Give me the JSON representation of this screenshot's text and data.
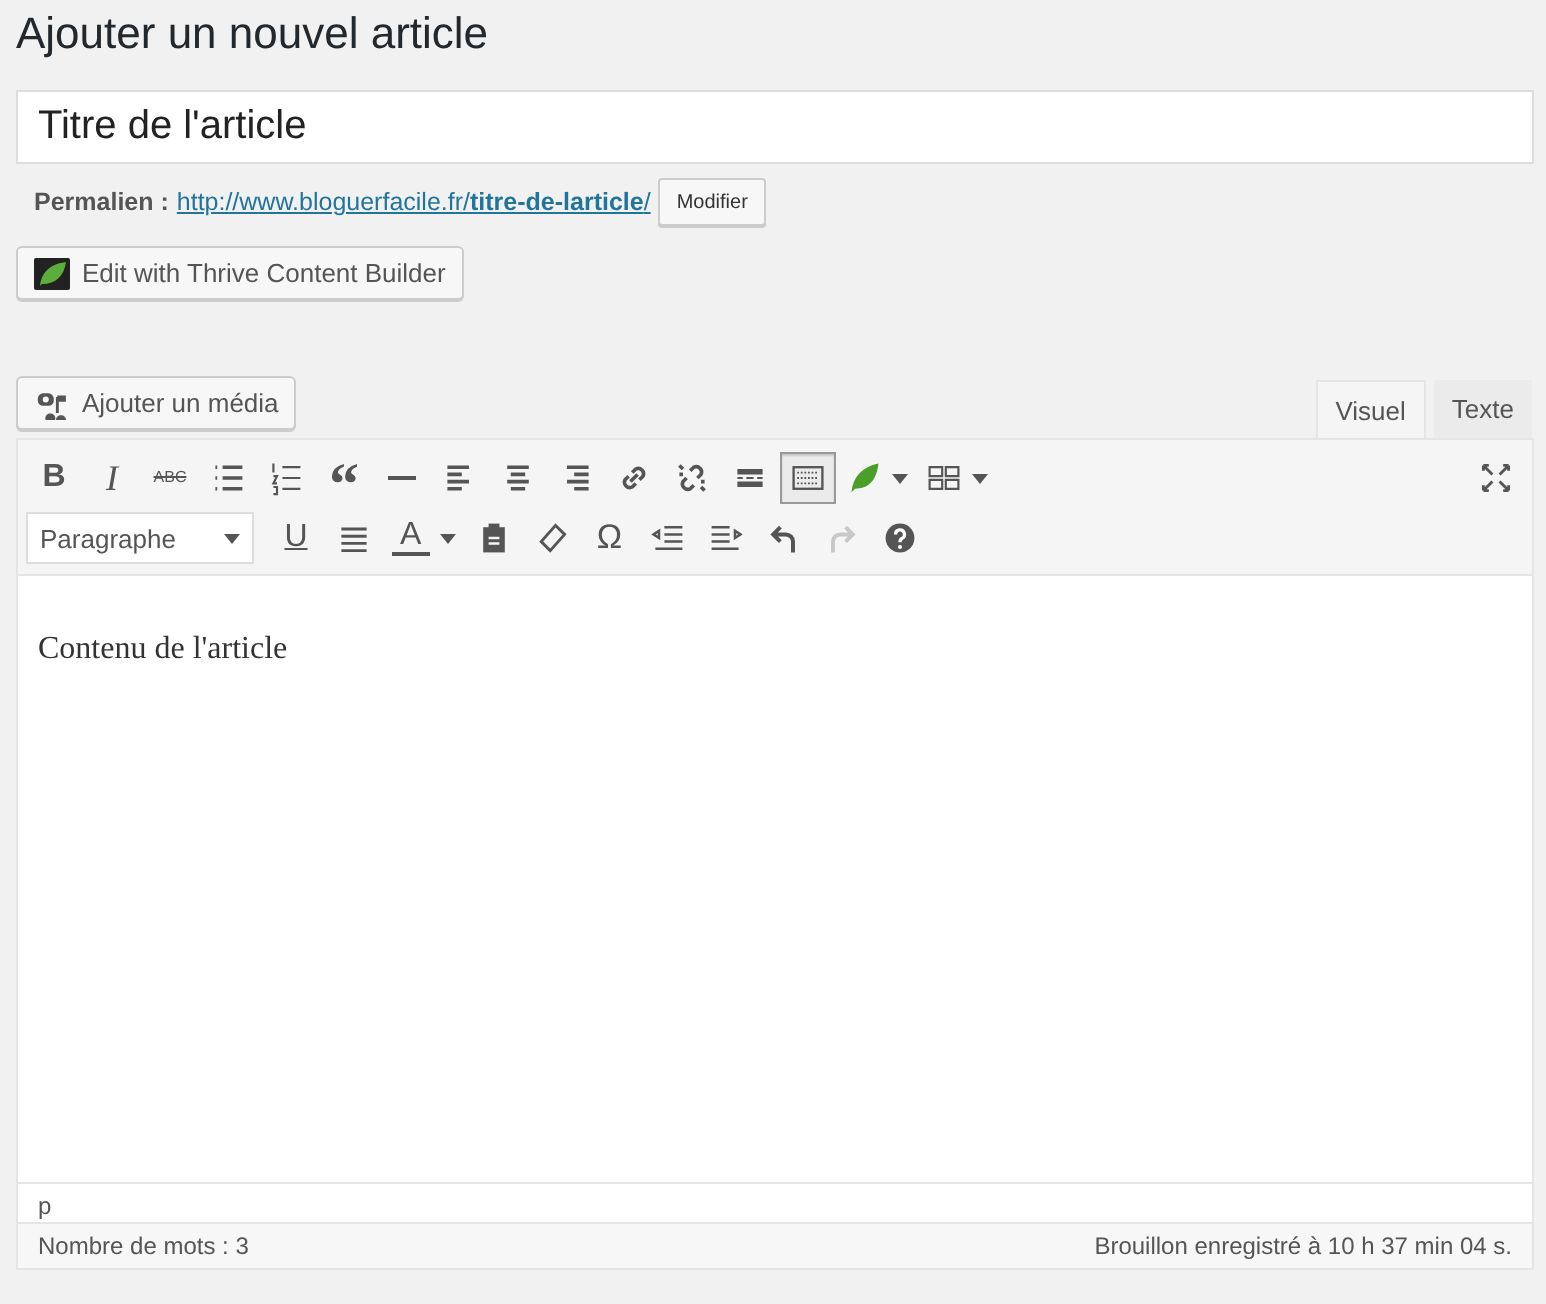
{
  "page_title": "Ajouter un nouvel article",
  "title_field": {
    "value": "Titre de l'article"
  },
  "permalink": {
    "label": "Permalien :",
    "url_base": "http://www.bloguerfacile.fr/",
    "url_slug": "titre-de-larticle",
    "url_end": "/",
    "button": "Modifier"
  },
  "builder_button": "Edit with Thrive Content Builder",
  "media_button": "Ajouter un média",
  "tabs": [
    {
      "label": "Visuel",
      "selected": true
    },
    {
      "label": "Texte",
      "selected": false
    }
  ],
  "toolbar": {
    "bold": "B",
    "italic": "I",
    "strike": "ABC",
    "quote": "“",
    "format": "Paragraphe",
    "underline": "U",
    "text_color": "A",
    "special_char": "Ω",
    "toolbar_toggle": {
      "pressed": true
    },
    "redo": {
      "disabled": true
    }
  },
  "content": "Contenu de l'article",
  "path": "p",
  "status_bar": {
    "word_count": "Nombre de mots : 3",
    "saved": "Brouillon enregistré à 10 h 37 min 04 s."
  }
}
